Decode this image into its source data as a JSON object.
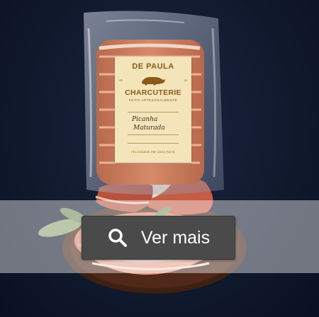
{
  "label": {
    "brand_top": "DE PAULA",
    "brand_sp": "SP",
    "brand_year": "20",
    "brand_main": "CHARCUTERIE",
    "brand_sub": "FEITO ARTESANALMENTE",
    "product_line1": "Picanha",
    "product_line2": "Maturada",
    "footer": "FELICIDADE EM CADA FATIA"
  },
  "button": {
    "label": "Ver mais",
    "icon": "search-icon"
  },
  "colors": {
    "background": "#111a2e",
    "label_card": "#f3e4b9",
    "brand_text": "#8a5a1a",
    "button_bg": "#4a4a4a",
    "overlay": "rgba(255,255,255,0.42)"
  }
}
